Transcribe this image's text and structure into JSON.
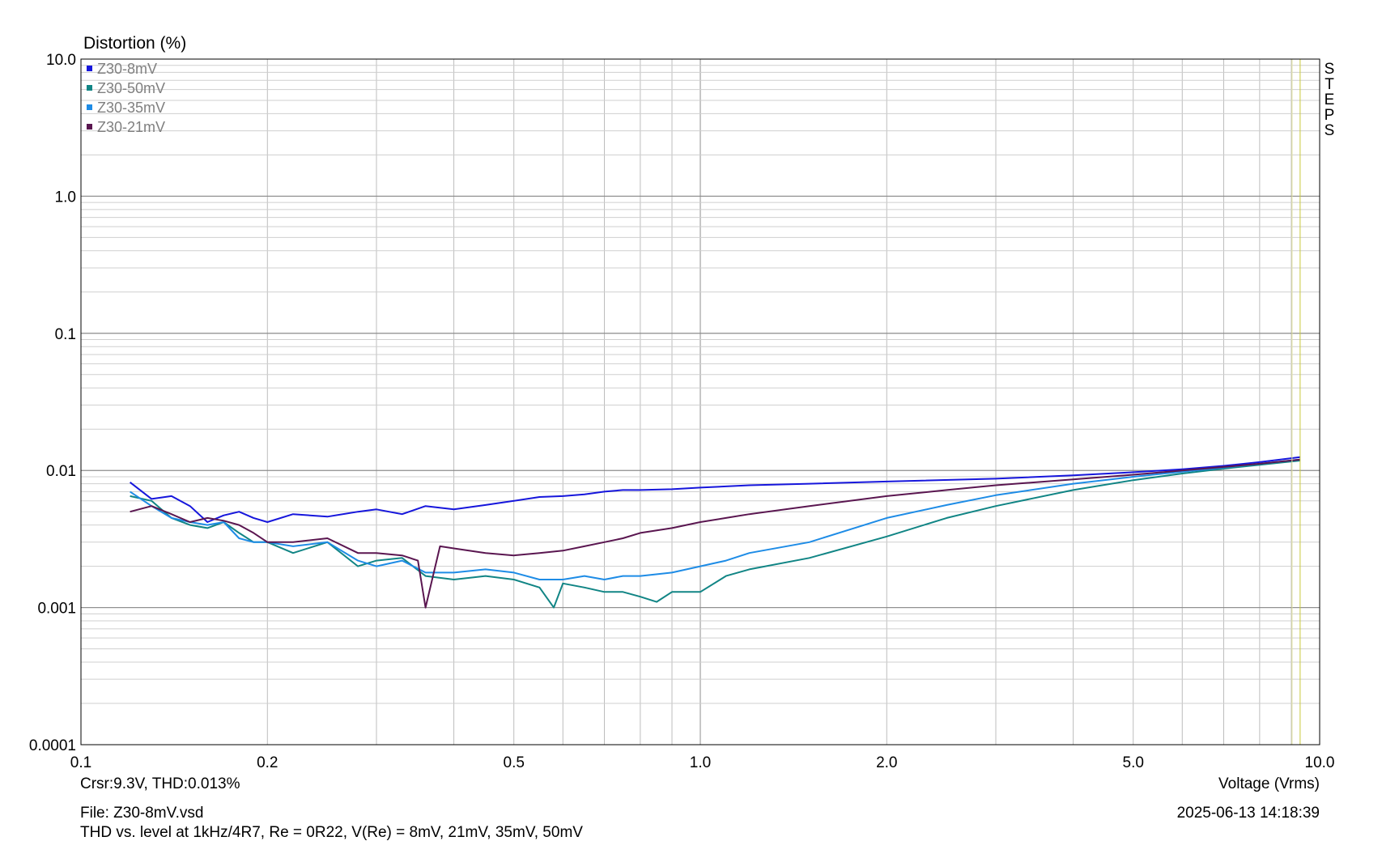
{
  "chart_data": {
    "type": "line",
    "title": "Distortion (%)",
    "xlabel": "Voltage (Vrms)",
    "ylabel": "Distortion (%)",
    "x_scale": "log",
    "y_scale": "log",
    "xlim": [
      0.1,
      10.0
    ],
    "ylim": [
      0.0001,
      10.0
    ],
    "x_ticks": [
      0.1,
      0.2,
      0.5,
      1.0,
      2.0,
      5.0,
      10.0
    ],
    "x_tick_labels": [
      "0.1",
      "0.2",
      "0.5",
      "1.0",
      "2.0",
      "5.0",
      "10.0"
    ],
    "y_ticks": [
      0.0001,
      0.001,
      0.01,
      0.1,
      1.0,
      10.0
    ],
    "y_tick_labels": [
      "0.0001",
      "0.001",
      "0.01",
      "0.1",
      "1.0",
      "10.0"
    ],
    "grid": true,
    "legend_position": "top-left",
    "side_label": "STEPS",
    "cursor_x": 9.3,
    "series": [
      {
        "name": "Z30-8mV",
        "color": "#1616dc",
        "x": [
          0.12,
          0.13,
          0.14,
          0.15,
          0.16,
          0.17,
          0.18,
          0.19,
          0.2,
          0.22,
          0.25,
          0.28,
          0.3,
          0.33,
          0.36,
          0.4,
          0.45,
          0.5,
          0.55,
          0.6,
          0.65,
          0.7,
          0.75,
          0.8,
          0.9,
          1.0,
          1.2,
          1.5,
          2.0,
          3.0,
          4.0,
          5.0,
          6.0,
          7.0,
          8.0,
          9.3
        ],
        "y": [
          0.0082,
          0.0062,
          0.0065,
          0.0055,
          0.0042,
          0.0047,
          0.005,
          0.0045,
          0.0042,
          0.0048,
          0.0046,
          0.005,
          0.0052,
          0.0048,
          0.0055,
          0.0052,
          0.0056,
          0.006,
          0.0064,
          0.0065,
          0.0067,
          0.007,
          0.0072,
          0.0072,
          0.0073,
          0.0075,
          0.0078,
          0.008,
          0.0083,
          0.0087,
          0.0092,
          0.0097,
          0.0102,
          0.0108,
          0.0115,
          0.0125
        ]
      },
      {
        "name": "Z30-50mV",
        "color": "#118585",
        "x": [
          0.12,
          0.13,
          0.14,
          0.15,
          0.16,
          0.17,
          0.18,
          0.19,
          0.2,
          0.22,
          0.25,
          0.28,
          0.3,
          0.33,
          0.36,
          0.4,
          0.45,
          0.5,
          0.55,
          0.58,
          0.6,
          0.65,
          0.7,
          0.75,
          0.8,
          0.85,
          0.9,
          1.0,
          1.1,
          1.2,
          1.5,
          2.0,
          2.5,
          3.0,
          4.0,
          5.0,
          6.0,
          7.0,
          8.0,
          9.3
        ],
        "y": [
          0.0065,
          0.006,
          0.0045,
          0.004,
          0.0038,
          0.0042,
          0.0035,
          0.003,
          0.003,
          0.0025,
          0.003,
          0.002,
          0.0022,
          0.0023,
          0.0017,
          0.0016,
          0.0017,
          0.0016,
          0.0014,
          0.001,
          0.0015,
          0.0014,
          0.0013,
          0.0013,
          0.0012,
          0.0011,
          0.0013,
          0.0013,
          0.0017,
          0.0019,
          0.0023,
          0.0033,
          0.0045,
          0.0055,
          0.0072,
          0.0085,
          0.0095,
          0.0103,
          0.011,
          0.0118
        ]
      },
      {
        "name": "Z30-35mV",
        "color": "#1e8ce6",
        "x": [
          0.12,
          0.13,
          0.14,
          0.15,
          0.16,
          0.17,
          0.18,
          0.19,
          0.2,
          0.22,
          0.25,
          0.28,
          0.3,
          0.33,
          0.36,
          0.4,
          0.45,
          0.5,
          0.55,
          0.6,
          0.65,
          0.7,
          0.75,
          0.8,
          0.9,
          1.0,
          1.1,
          1.2,
          1.5,
          2.0,
          2.5,
          3.0,
          4.0,
          5.0,
          6.0,
          7.0,
          8.0,
          9.3
        ],
        "y": [
          0.007,
          0.0055,
          0.0045,
          0.0042,
          0.004,
          0.0042,
          0.0032,
          0.003,
          0.003,
          0.0028,
          0.003,
          0.0022,
          0.002,
          0.0022,
          0.0018,
          0.0018,
          0.0019,
          0.0018,
          0.0016,
          0.0016,
          0.0017,
          0.0016,
          0.0017,
          0.0017,
          0.0018,
          0.002,
          0.0022,
          0.0025,
          0.003,
          0.0045,
          0.0056,
          0.0066,
          0.008,
          0.009,
          0.0098,
          0.0105,
          0.0112,
          0.012
        ]
      },
      {
        "name": "Z30-21mV",
        "color": "#5a1650",
        "x": [
          0.12,
          0.13,
          0.14,
          0.15,
          0.16,
          0.17,
          0.18,
          0.19,
          0.2,
          0.22,
          0.25,
          0.28,
          0.3,
          0.33,
          0.35,
          0.36,
          0.38,
          0.4,
          0.45,
          0.5,
          0.55,
          0.6,
          0.65,
          0.7,
          0.75,
          0.8,
          0.9,
          1.0,
          1.1,
          1.2,
          1.5,
          2.0,
          2.5,
          3.0,
          4.0,
          5.0,
          6.0,
          7.0,
          8.0,
          9.3
        ],
        "y": [
          0.005,
          0.0055,
          0.0048,
          0.0042,
          0.0045,
          0.0043,
          0.004,
          0.0035,
          0.003,
          0.003,
          0.0032,
          0.0025,
          0.0025,
          0.0024,
          0.0022,
          0.001,
          0.0028,
          0.0027,
          0.0025,
          0.0024,
          0.0025,
          0.0026,
          0.0028,
          0.003,
          0.0032,
          0.0035,
          0.0038,
          0.0042,
          0.0045,
          0.0048,
          0.0055,
          0.0065,
          0.0072,
          0.0078,
          0.0086,
          0.0093,
          0.01,
          0.0106,
          0.0112,
          0.012
        ]
      }
    ]
  },
  "footer": {
    "cursor_readout": "Crsr:9.3V, THD:0.013%",
    "x_axis_label": "Voltage (Vrms)",
    "file": "File: Z30-8mV.vsd",
    "timestamp": "2025-06-13  14:18:39",
    "description": "THD vs. level at 1kHz/4R7, Re = 0R22, V(Re) = 8mV, 21mV, 35mV, 50mV"
  }
}
